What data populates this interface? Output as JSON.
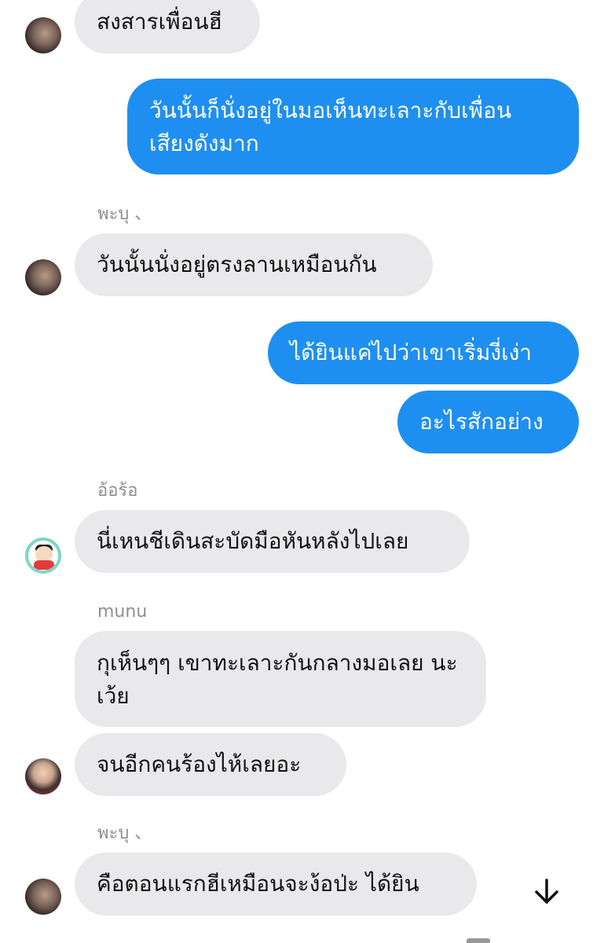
{
  "messages": [
    {
      "side": "in",
      "text": "สงสารเพื่อนฮี"
    },
    {
      "side": "out",
      "text": "วันนั้นก็นั่งอยู่ในมอเห็นทะเลาะกับเพื่อน เสียงดังมาก"
    },
    {
      "side": "in",
      "sender": "พะบุ 、",
      "text": "วันนั้นนั่งอยู่ตรงลานเหมือนกัน"
    },
    {
      "side": "out",
      "text": "ได้ยินแค่ไปว่าเขาเริ่มงี่เง่า"
    },
    {
      "side": "out",
      "text": "อะไรสักอย่าง"
    },
    {
      "side": "in",
      "sender": "อ้อร้อ",
      "text": "นี่เหนชีเดินสะบัดมือหันหลังไปเลย"
    },
    {
      "side": "in",
      "sender": "munu",
      "text": "กุเห็นๆๆ เขาทะเลาะกันกลางมอเลย นะเว้ย"
    },
    {
      "side": "in",
      "text": "จนอีกคนร้องไห้เลยอะ"
    },
    {
      "side": "in",
      "sender": "พะบุ 、",
      "text": "คือตอนแรกฮีเหมือนจะง้อป่ะ ได้ยิน"
    }
  ],
  "icons": {
    "scroll_down": "arrow-down-icon"
  },
  "colors": {
    "incoming_bubble": "#e9e9eb",
    "outgoing_bubble": "#1e8ff0",
    "sender_name": "#8e8e93"
  }
}
